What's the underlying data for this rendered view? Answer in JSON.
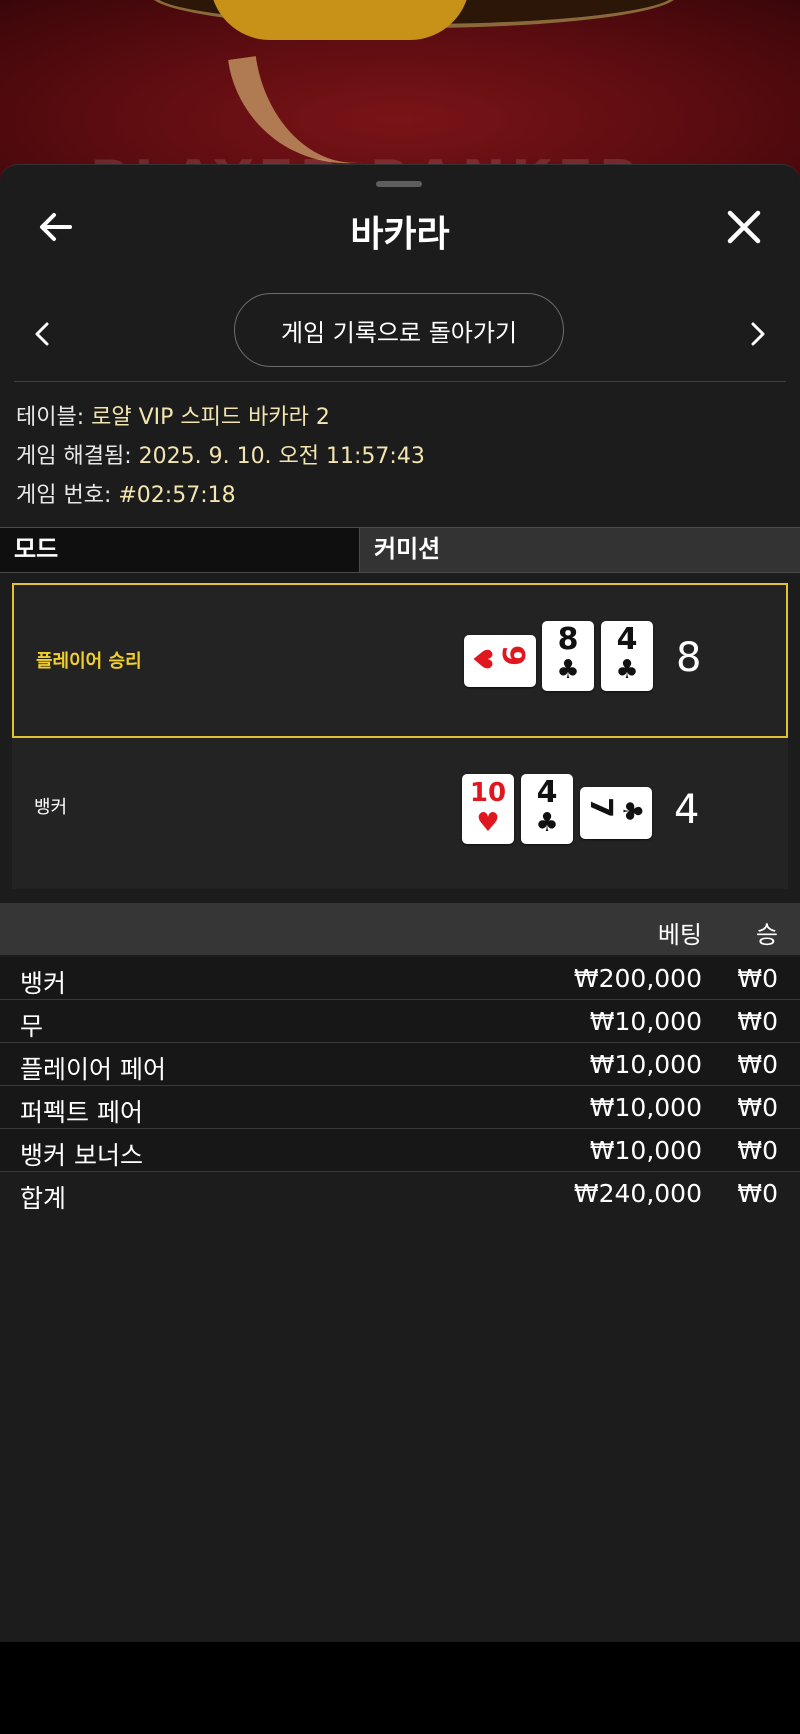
{
  "background": {
    "ghost_text": "PLAYER  BANKER"
  },
  "header": {
    "title": "바카라"
  },
  "history_button": "게임 기록으로 돌아가기",
  "info": {
    "table_label": "테이블:",
    "table_value": "로얄 VIP 스피드 바카라 2",
    "resolved_label": "게임 해결됨:",
    "resolved_value": "2025. 9. 10. 오전 11:57:43",
    "number_label": "게임 번호:",
    "number_value": "#02:57:18"
  },
  "mode": {
    "label": "모드",
    "value": "커미션"
  },
  "result": {
    "player": {
      "label": "플레이어 승리",
      "score": "8",
      "cards": [
        {
          "rank": "9",
          "suit": "♥",
          "color": "#e0171f",
          "orientation": "horizontal"
        },
        {
          "rank": "8",
          "suit": "♣",
          "color": "#111111",
          "orientation": "vertical"
        },
        {
          "rank": "4",
          "suit": "♣",
          "color": "#111111",
          "orientation": "vertical"
        }
      ]
    },
    "banker": {
      "label": "뱅커",
      "score": "4",
      "cards": [
        {
          "rank": "10",
          "suit": "♥",
          "color": "#e0171f",
          "orientation": "vertical"
        },
        {
          "rank": "4",
          "suit": "♣",
          "color": "#111111",
          "orientation": "vertical"
        },
        {
          "rank": "7",
          "suit": "♣",
          "color": "#111111",
          "orientation": "horizontal"
        }
      ]
    }
  },
  "bets": {
    "header_bet": "베팅",
    "header_win": "승",
    "rows": [
      {
        "name": "뱅커",
        "amount": "₩200,000",
        "win": "₩0"
      },
      {
        "name": "무",
        "amount": "₩10,000",
        "win": "₩0"
      },
      {
        "name": "플레이어 페어",
        "amount": "₩10,000",
        "win": "₩0"
      },
      {
        "name": "퍼펙트 페어",
        "amount": "₩10,000",
        "win": "₩0"
      },
      {
        "name": "뱅커 보너스",
        "amount": "₩10,000",
        "win": "₩0"
      }
    ],
    "total": {
      "name": "합계",
      "amount": "₩240,000",
      "win": "₩0"
    }
  },
  "colors": {
    "accent": "#e1c233",
    "winner_text": "#f3cf2e",
    "info_value": "#f3e5b0",
    "sheet_bg": "#1c1c1c"
  },
  "icons": {
    "back": "arrow-left-icon",
    "close": "close-icon",
    "prev": "chevron-left-icon",
    "next": "chevron-right-icon"
  }
}
